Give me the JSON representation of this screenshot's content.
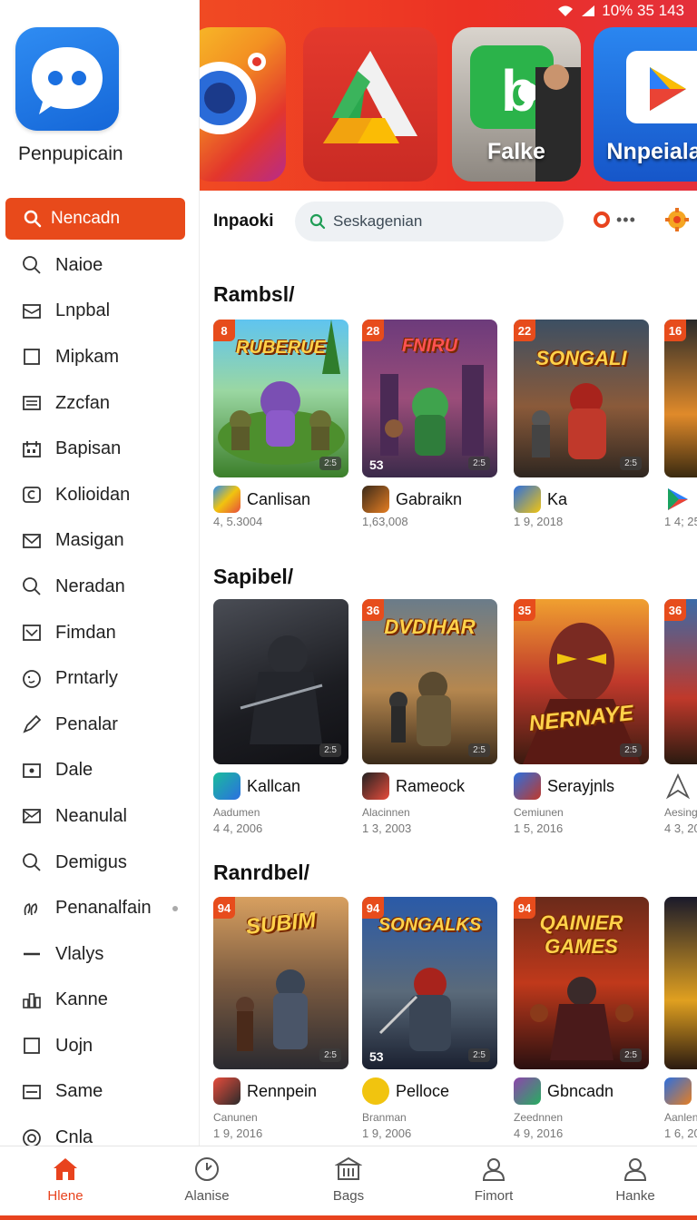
{
  "status_bar": {
    "text": "10% 35 143"
  },
  "sidebar": {
    "app_name": "Penpupicain",
    "active_item": "Nencadn",
    "items": [
      {
        "label": "Naioe",
        "icon": "search-icon"
      },
      {
        "label": "Lnpbal",
        "icon": "image-icon"
      },
      {
        "label": "Mipkam",
        "icon": "square-icon"
      },
      {
        "label": "Zzcfan",
        "icon": "list-icon"
      },
      {
        "label": "Bapisan",
        "icon": "calendar-icon"
      },
      {
        "label": "Kolioidan",
        "icon": "chat-icon"
      },
      {
        "label": "Masigan",
        "icon": "mail-icon"
      },
      {
        "label": "Neradan",
        "icon": "search-icon"
      },
      {
        "label": "Fimdan",
        "icon": "inbox-icon"
      },
      {
        "label": "Prntarly",
        "icon": "face-icon"
      },
      {
        "label": "Penalar",
        "icon": "pen-icon"
      },
      {
        "label": "Dale",
        "icon": "camera-icon"
      },
      {
        "label": "Neanulal",
        "icon": "mail-icon"
      },
      {
        "label": "Demigus",
        "icon": "search-icon"
      },
      {
        "label": "Penanalfain",
        "icon": "link-icon"
      },
      {
        "label": "Vlalys",
        "icon": "minus-icon"
      },
      {
        "label": "Kanne",
        "icon": "bar-chart-icon"
      },
      {
        "label": "Uojn",
        "icon": "square-icon"
      },
      {
        "label": "Same",
        "icon": "split-icon"
      },
      {
        "label": "Cnla",
        "icon": "target-icon"
      }
    ]
  },
  "banner": {
    "tiles": [
      {
        "label": "",
        "icon": "camera-app-icon"
      },
      {
        "label": "",
        "icon": "drive-app-icon"
      },
      {
        "label": "Falke",
        "icon": "chat-app-icon"
      },
      {
        "label": "Nnpeialal",
        "icon": "play-app-icon"
      }
    ]
  },
  "search": {
    "section_label": "Inpaoki",
    "placeholder": "Seskagenian"
  },
  "sections": [
    {
      "title": "Rambsl/",
      "cards": [
        {
          "badge": "8",
          "name": "Canlisan",
          "sub": "",
          "num": "4, 5.3004",
          "art": "RUBERUE",
          "corner": "2:5",
          "bl": ""
        },
        {
          "badge": "28",
          "name": "Gabraikn",
          "sub": "",
          "num": "1,63,008",
          "art": "FNIRU",
          "corner": "2:5",
          "bl": "53"
        },
        {
          "badge": "22",
          "name": "Ka",
          "sub": "",
          "num": "1 9, 2018",
          "art": "SONGALI",
          "corner": "2:5",
          "bl": ""
        },
        {
          "badge": "16",
          "name": "",
          "sub": "",
          "num": "1 4; 25",
          "art": "",
          "corner": "",
          "bl": ""
        }
      ]
    },
    {
      "title": "Sapibel/",
      "cards": [
        {
          "badge": "",
          "name": "Kallcan",
          "sub": "Aadumen",
          "num": "4 4, 2006",
          "art": "",
          "corner": "2:5",
          "bl": ""
        },
        {
          "badge": "36",
          "name": "Rameock",
          "sub": "Alacinnen",
          "num": "1 3, 2003",
          "art": "DVDIHAR",
          "corner": "2:5",
          "bl": ""
        },
        {
          "badge": "35",
          "name": "Serayjnls",
          "sub": "Cemiunen",
          "num": "1 5, 2016",
          "art": "NERNAYE",
          "corner": "2:5",
          "bl": ""
        },
        {
          "badge": "36",
          "name": "",
          "sub": "Aesing",
          "num": "4 3, 20",
          "art": "",
          "corner": "",
          "bl": ""
        }
      ]
    },
    {
      "title": "Ranrdbel/",
      "cards": [
        {
          "badge": "94",
          "name": "Rennpein",
          "sub": "Canunen",
          "num": "1 9, 2016",
          "art": "SUBIM",
          "corner": "2:5",
          "bl": ""
        },
        {
          "badge": "94",
          "name": "Pelloce",
          "sub": "Branman",
          "num": "1 9, 2006",
          "art": "SONGALKS",
          "corner": "2:5",
          "bl": "53"
        },
        {
          "badge": "94",
          "name": "Gbncadn",
          "sub": "Zeednnen",
          "num": "4 9, 2016",
          "art": "QAINIER GAMES",
          "corner": "2:5",
          "bl": ""
        },
        {
          "badge": "",
          "name": "",
          "sub": "Aanlen",
          "num": "1 6, 20",
          "art": "",
          "corner": "",
          "bl": ""
        }
      ]
    }
  ],
  "bottom_nav": [
    {
      "label": "Hlene",
      "icon": "home-icon"
    },
    {
      "label": "Alanise",
      "icon": "clock-icon"
    },
    {
      "label": "Bags",
      "icon": "bank-icon"
    },
    {
      "label": "Fimort",
      "icon": "person-icon"
    },
    {
      "label": "Hanke",
      "icon": "person-icon"
    }
  ],
  "colors": {
    "accent": "#e8431e",
    "banner": "#ec3124",
    "logo": "#1a6fe0"
  }
}
